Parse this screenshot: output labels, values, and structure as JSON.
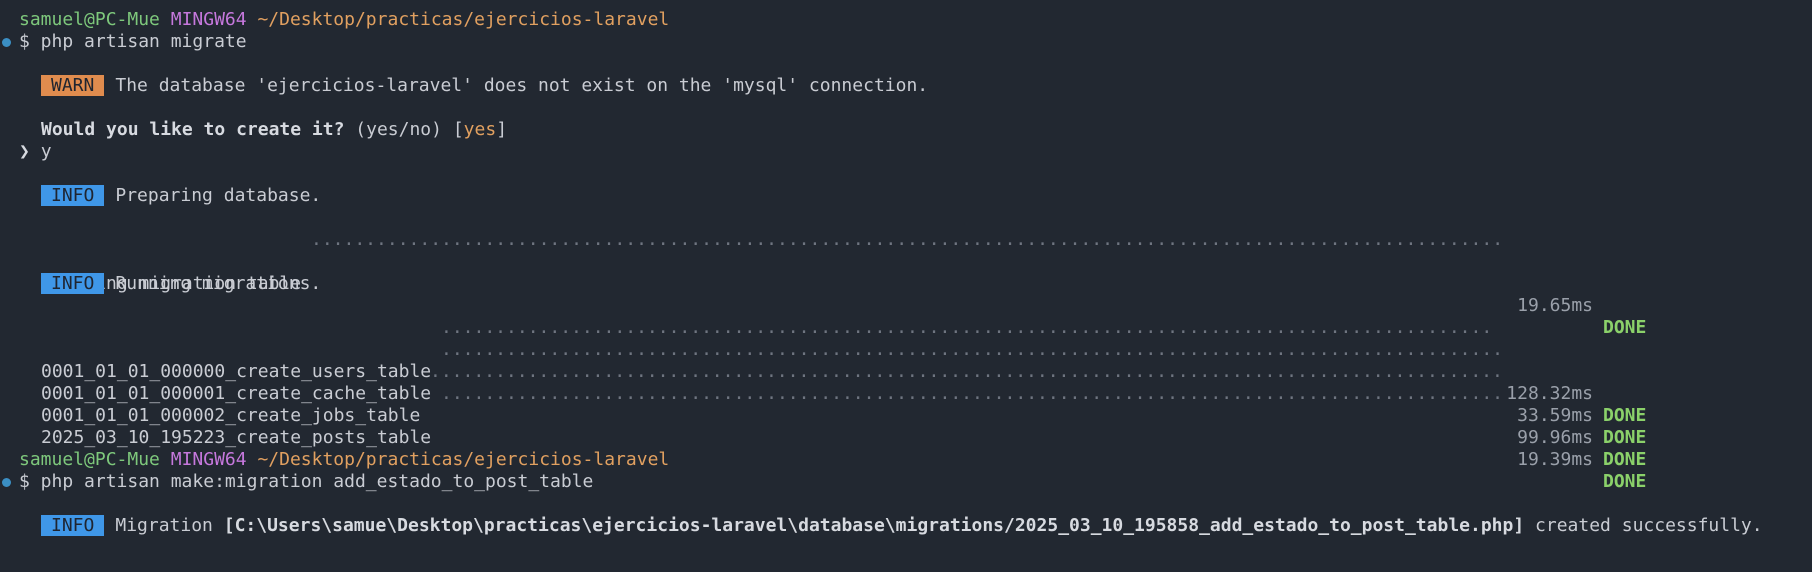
{
  "colors": {
    "background": "#222831",
    "user": "#7ec87c",
    "host": "#c678dd",
    "path": "#e1a060",
    "prompt_dot": "#3b8fc4",
    "warn_badge": "#e08c4e",
    "info_badge": "#3f97e8",
    "done": "#8bd16a"
  },
  "session1": {
    "prompt": {
      "user_host": "samuel@PC-Mue",
      "shell": "MINGW64",
      "cwd": "~/Desktop/practicas/ejercicios-laravel"
    },
    "command": "$ php artisan migrate",
    "warn": {
      "badge": "WARN",
      "message": "The database 'ejercicios-laravel' does not exist on the 'mysql' connection."
    },
    "question": {
      "text": "Would you like to create it?",
      "options": "(yes/no)",
      "bracket_open": "[",
      "default": "yes",
      "bracket_close": "]"
    },
    "answer": {
      "chevron": "❯",
      "value": "y"
    },
    "info1": {
      "badge": "INFO",
      "message": "Preparing database."
    },
    "migration_table": {
      "name": "Creating migration table",
      "time": "19.65ms",
      "status": "DONE"
    },
    "info2": {
      "badge": "INFO",
      "message": "Running migrations."
    },
    "migrations": [
      {
        "name": "0001_01_01_000000_create_users_table",
        "time": "128.32ms",
        "status": "DONE"
      },
      {
        "name": "0001_01_01_000001_create_cache_table",
        "time": "33.59ms",
        "status": "DONE"
      },
      {
        "name": "0001_01_01_000002_create_jobs_table",
        "time": "99.96ms",
        "status": "DONE"
      },
      {
        "name": "2025_03_10_195223_create_posts_table",
        "time": "19.39ms",
        "status": "DONE"
      }
    ]
  },
  "session2": {
    "prompt": {
      "user_host": "samuel@PC-Mue",
      "shell": "MINGW64",
      "cwd": "~/Desktop/practicas/ejercicios-laravel"
    },
    "command": "$ php artisan make:migration add_estado_to_post_table",
    "info": {
      "badge": "INFO",
      "prefix": "Migration",
      "path": "[C:\\Users\\samue\\Desktop\\practicas\\ejercicios-laravel\\database\\migrations/2025_03_10_195858_add_estado_to_post_table.php]",
      "suffix": "created successfully."
    }
  }
}
